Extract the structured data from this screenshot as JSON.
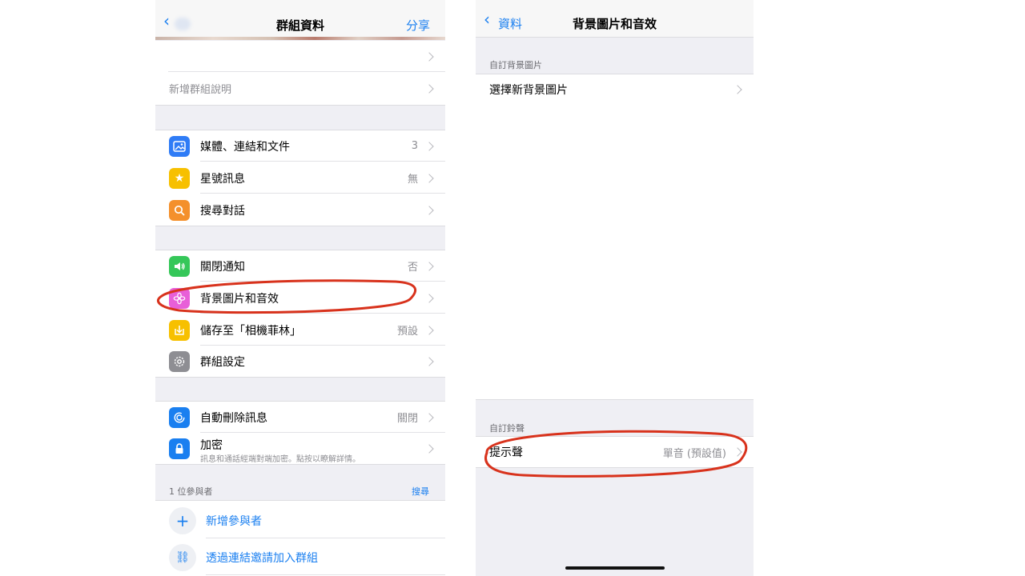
{
  "left_screen": {
    "nav": {
      "title": "群組資料",
      "share": "分享"
    },
    "top_rows": [
      {
        "label": ""
      },
      {
        "label": "新增群組說明"
      }
    ],
    "group1": [
      {
        "label": "媒體、連結和文件",
        "value": "3",
        "icon": "photo-icon",
        "color": "#2f7cf6"
      },
      {
        "label": "星號訊息",
        "value": "無",
        "icon": "star-icon",
        "color": "#f7c000"
      },
      {
        "label": "搜尋對話",
        "value": "",
        "icon": "search-icon",
        "color": "#f4902c"
      }
    ],
    "group2": [
      {
        "label": "關閉通知",
        "value": "否",
        "icon": "speaker-icon",
        "color": "#35c759"
      },
      {
        "label": "背景圖片和音效",
        "value": "",
        "icon": "flower-icon",
        "color": "#e85fd8"
      },
      {
        "label": "儲存至「相機菲林」",
        "value": "預設",
        "icon": "save-icon",
        "color": "#f7c000"
      },
      {
        "label": "群組設定",
        "value": "",
        "icon": "gear-icon",
        "color": "#8e8e93"
      }
    ],
    "group3": [
      {
        "label": "自動刪除訊息",
        "value": "關閉",
        "icon": "timer-icon",
        "color": "#1a7ff0"
      },
      {
        "label": "加密",
        "sublabel": "訊息和通話經端對端加密。點按以瞭解詳情。",
        "value": "",
        "icon": "lock-icon",
        "color": "#1a7ff0"
      }
    ],
    "participants": {
      "header": "1 位參與者",
      "search": "搜尋",
      "actions": [
        {
          "label": "新增參與者",
          "icon": "plus-icon",
          "glyph": "+"
        },
        {
          "label": "透過連結邀請加入群組",
          "icon": "link-icon",
          "glyph": "⛓"
        }
      ]
    }
  },
  "right_screen": {
    "nav": {
      "back": "資料",
      "title": "背景圖片和音效"
    },
    "wallpaper_section": {
      "header": "自訂背景圖片",
      "row": "選擇新背景圖片"
    },
    "sound_section": {
      "header": "自訂鈴聲",
      "row_label": "提示聲",
      "row_value": "單音 (預設值)"
    }
  },
  "colors": {
    "accent": "#1a7ff0",
    "annotation": "#d8321c",
    "background": "#efeff4"
  }
}
